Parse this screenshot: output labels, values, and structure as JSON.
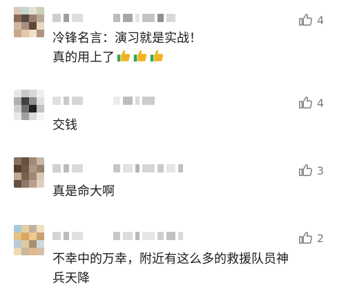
{
  "comments": [
    {
      "likes": "4",
      "lines": [
        "冷锋名言：演习就是实战！",
        "真的用上了"
      ],
      "emoji": [
        "thumbs-up",
        "thumbs-up",
        "thumbs-up"
      ],
      "name_colors": [
        "#cfcfcf",
        "#9e9e9e",
        "#dedede",
        "#bcbcbc",
        "#a8a8a8",
        "#e4e4e4",
        "#c4c4c4",
        "#8f8f8f",
        "#d8d8d8"
      ],
      "avatar_colors": [
        "#d8c8b8",
        "#c0d8d0",
        "#e8e0d0",
        "#c8d0b8",
        "#8a6a5a",
        "#5a4a40",
        "#9a8070",
        "#b8a898",
        "#d0b8a0",
        "#a89080",
        "#604838",
        "#e8d8c0",
        "#c8a888",
        "#e0c8a8",
        "#f0e0c8",
        "#b09080"
      ]
    },
    {
      "likes": "4",
      "lines": [
        "交钱"
      ],
      "name_colors": [
        "#e0e0e0",
        "#c8c8c8",
        "#d6d6d6",
        "#ececec",
        "#bdbdbd",
        "#dadada",
        "#cccccc"
      ],
      "avatar_colors": [
        "#e8e8e8",
        "#c8c8c8",
        "#d8d8d8",
        "#f0f0f0",
        "#b0b0b0",
        "#404040",
        "#909090",
        "#e0e0e0",
        "#d0d0d0",
        "#707070",
        "#202020",
        "#c0c0c0",
        "#e8e8e8",
        "#a0a0a0",
        "#d8d8d8",
        "#f4f4f4"
      ]
    },
    {
      "likes": "3",
      "lines": [
        "真是命大啊"
      ],
      "name_colors": [
        "#d0d0d0",
        "#bbbbbb",
        "#dadada",
        "#c6c6c6",
        "#e2e2e2",
        "#b4b4b4",
        "#d6d6d6",
        "#cacaca",
        "#e6e6e6",
        "#c0c0c0"
      ],
      "avatar_colors": [
        "#8a7060",
        "#6a5040",
        "#a08a78",
        "#c8b8a8",
        "#504030",
        "#705848",
        "#b09880",
        "#988070",
        "#c0a890",
        "#786050",
        "#a08870",
        "#d8c8b8",
        "#605040",
        "#907868",
        "#b8a090",
        "#e0d0c0"
      ]
    },
    {
      "likes": "2",
      "lines": [
        "不幸中的万幸，附近有这么多的救援队员神",
        "兵天降"
      ],
      "name_colors": [
        "#d4d4d4",
        "#bdbdbd",
        "#e0e0e0",
        "#c8c8c8",
        "#dcdcdc",
        "#b8b8b8",
        "#e6e6e6",
        "#cfcfcf",
        "#c2c2c2",
        "#dadada"
      ],
      "avatar_colors": [
        "#a8c8e0",
        "#e8d0a0",
        "#c0b0a0",
        "#f0e0c0",
        "#e8c080",
        "#d8a860",
        "#f0c890",
        "#c8a070",
        "#b8c8d8",
        "#e0c8a0",
        "#a89070",
        "#d0d8e0",
        "#f0d8b0",
        "#c8b8a0",
        "#e0b890",
        "#d8c0a8"
      ]
    }
  ],
  "colors": {
    "like_gray": "#7a7a7a",
    "thumb_yellow": "#f2b31f",
    "thumb_green": "#3ba548"
  }
}
